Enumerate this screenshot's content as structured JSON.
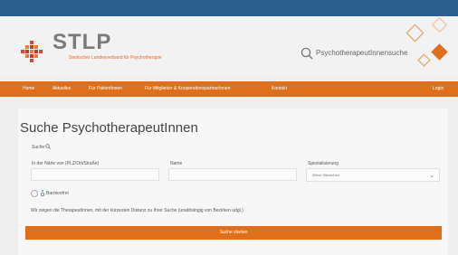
{
  "header": {
    "logo_title": "STLP",
    "logo_subtitle": "Steirischer Landesverband für Psychotherapie",
    "search_link": "PsychotherapeutInnensuche",
    "accent_color": "#e06f1b"
  },
  "nav": {
    "items": [
      {
        "label": "Home"
      },
      {
        "label": "Aktuelles"
      },
      {
        "label": "Für PatientInnen"
      },
      {
        "label": "Für Mitglieder & KooperationspartnerInnen"
      },
      {
        "label": "Kontakt"
      }
    ],
    "login": "Login"
  },
  "form": {
    "heading": "Suche PsychotherapeutInnen",
    "search_label": "Suche",
    "location_label": "In der Nähe von (PLZ/Ort/Straße)",
    "name_label": "Name",
    "specialization_label": "Spezialisierung",
    "specialization_value": "Ältere Menschen",
    "barrier_free_label": "Barrierefrei",
    "info_text": "Wir zeigen die TherapeutInnen, mit der kürzesten Distanz zu Ihrer Suche (unabhängig von Bezirken udgl.)",
    "submit_label": "Suche starten"
  }
}
